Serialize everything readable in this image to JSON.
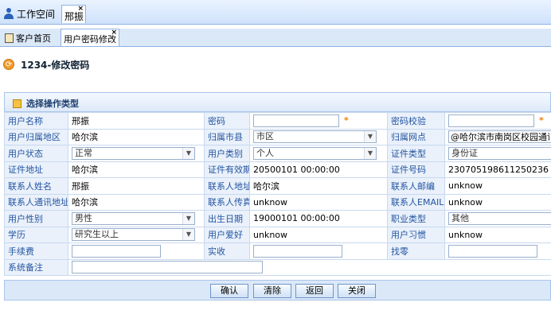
{
  "top_tabs": {
    "workspace": "工作空间",
    "active_tab": "邢振",
    "close": "×"
  },
  "sub_tabs": {
    "home": "客户首页",
    "active": "用户密码修改",
    "close": "×"
  },
  "page": {
    "title": "1234-修改密码"
  },
  "section": {
    "title": "选择操作类型"
  },
  "form": {
    "username_label": "用户名称",
    "username": "邢振",
    "password_label": "密码",
    "password_value": "",
    "password_req": "*",
    "pwcheck_label": "密码校验",
    "pwcheck_value": "",
    "pwcheck_req": "*",
    "region_label": "用户归属地区",
    "region": "哈尔滨",
    "city_label": "归属市县",
    "city": "市区",
    "outlet_label": "归属网点",
    "outlet": "@哈尔滨市南岗区校园通讯",
    "status_label": "用户状态",
    "status": "正常",
    "type_label": "用户类别",
    "type": "个人",
    "idtype_label": "证件类型",
    "idtype": "身份证",
    "idaddr_label": "证件地址",
    "idaddr": "哈尔滨",
    "idvalid_label": "证件有效期",
    "idvalid": "20500101 00:00:00",
    "idno_label": "证件号码",
    "idno": "230705198611250236",
    "contact_label": "联系人姓名",
    "contact": "邢振",
    "contactaddr_label": "联系人地址",
    "contactaddr": "哈尔滨",
    "zip_label": "联系人邮编",
    "zip": "unknow",
    "commaddr_label": "联系人通讯地址",
    "commaddr": "哈尔滨",
    "fax_label": "联系人传真",
    "fax": "unknow",
    "email_label": "联系人EMAIL",
    "email": "unknow",
    "gender_label": "用户性别",
    "gender": "男性",
    "birth_label": "出生日期",
    "birth": "19000101 00:00:00",
    "job_label": "职业类型",
    "job": "其他",
    "edu_label": "学历",
    "edu": "研究生以上",
    "hobby_label": "用户爱好",
    "hobby": "unknow",
    "habit_label": "用户习惯",
    "habit": "unknow",
    "fee_label": "手续费",
    "fee": "",
    "paid_label": "实收",
    "paid": "",
    "change_label": "找零",
    "change": "",
    "remark_label": "系统备注",
    "remark": ""
  },
  "buttons": {
    "confirm": "确认",
    "clear": "清除",
    "back": "返回",
    "close": "关闭"
  },
  "colors": {
    "label_text": "#2355a0",
    "required": "#f08000",
    "tab_border": "#8db2e3"
  }
}
